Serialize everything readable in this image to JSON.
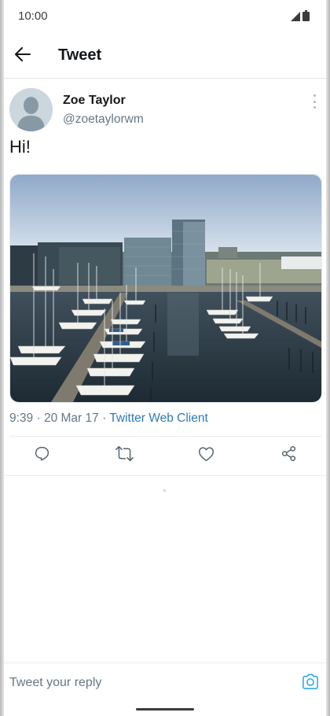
{
  "status_bar": {
    "time": "10:00",
    "icons": [
      "signal-icon",
      "battery-icon"
    ]
  },
  "app_bar": {
    "title": "Tweet",
    "back_icon": "arrow-left-icon"
  },
  "tweet": {
    "author_name": "Zoe Taylor",
    "author_handle": "@zoetaylorwm",
    "text": "Hi!",
    "media_description": "harbor-marina-photo",
    "time": "9:39",
    "date": "20 Mar 17",
    "separator": "·",
    "client": "Twitter Web Client"
  },
  "actions": [
    {
      "name": "reply",
      "icon": "comment-icon"
    },
    {
      "name": "retweet",
      "icon": "retweet-icon"
    },
    {
      "name": "like",
      "icon": "heart-icon"
    },
    {
      "name": "share",
      "icon": "share-icon"
    }
  ],
  "reply": {
    "placeholder": "Tweet your reply",
    "camera_icon": "camera-icon"
  },
  "colors": {
    "accent": "#1da1f2",
    "link": "#2b7bb9",
    "secondary_text": "#657786",
    "primary_text": "#14171a"
  }
}
